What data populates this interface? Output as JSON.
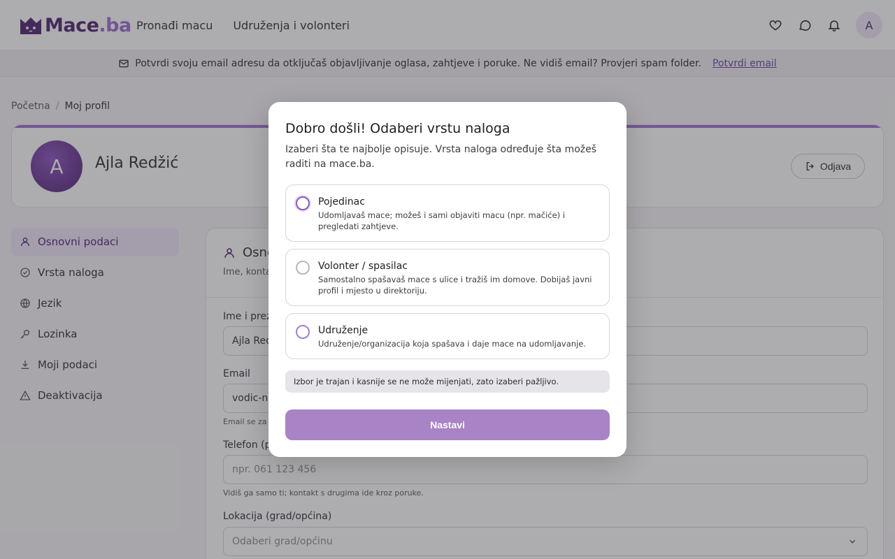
{
  "header": {
    "logo_text_main": "Mace",
    "logo_text_dot": ".ba",
    "nav": [
      {
        "label": "Pronađi macu"
      },
      {
        "label": "Udruženja i volonteri"
      }
    ],
    "icons": [
      "heart-icon",
      "chat-icon",
      "bell-icon"
    ],
    "avatar_initial": "A"
  },
  "banner": {
    "icon": "mail-icon",
    "text": "Potvrdi svoju email adresu da otključaš objavljivanje oglasa, zahtjeve i poruke. Ne vidiš email? Provjeri spam folder.",
    "link": "Potvrdi email"
  },
  "breadcrumb": {
    "home": "Početna",
    "separator": "/",
    "current": "Moj profil"
  },
  "profile": {
    "avatar_initial": "A",
    "name": "Ajla Redžić",
    "logout_label": "Odjava"
  },
  "sidebar": {
    "items": [
      {
        "label": "Osnovni podaci",
        "icon": "user-icon",
        "active": true
      },
      {
        "label": "Vrsta naloga",
        "icon": "check-circle-icon"
      },
      {
        "label": "Jezik",
        "icon": "globe-icon"
      },
      {
        "label": "Lozinka",
        "icon": "key-icon"
      },
      {
        "label": "Moji podaci",
        "icon": "download-icon"
      },
      {
        "label": "Deaktivacija",
        "icon": "warning-icon"
      }
    ]
  },
  "form": {
    "title": "Osno",
    "subtitle": "Ime, konta",
    "name_label": "Ime i prez",
    "name_value": "Ajla Red",
    "email_label": "Email",
    "email_value": "vodic-na",
    "email_help": "Email se za",
    "phone_label": "Telefon (p",
    "phone_placeholder": "npr. 061 123 456",
    "phone_help": "Vidiš ga samo ti; kontakt s drugima ide kroz poruke.",
    "location_label": "Lokacija (grad/općina)",
    "location_placeholder": "Odaberi grad/općinu"
  },
  "modal": {
    "title": "Dobro došli! Odaberi vrstu naloga",
    "description": "Izaberi šta te najbolje opisuje. Vrsta naloga određuje šta možeš raditi na mace.ba.",
    "options": [
      {
        "title": "Pojedinac",
        "description": "Udomljavaš mace; možeš i sami objaviti macu (npr. mačiće) i pregledati zahtjeve."
      },
      {
        "title": "Volonter / spasilac",
        "description": "Samostalno spašavaš mace s ulice i tražiš im domove. Dobijaš javni profil i mjesto u direktoriju."
      },
      {
        "title": "Udruženje",
        "description": "Udruženje/organizacija koja spašava i daje mace na udomljavanje."
      }
    ],
    "notice": "Izbor je trajan i kasnije se ne može mijenjati, zato izaberi pažljivo.",
    "continue_label": "Nastavi"
  },
  "colors": {
    "brand": "#4b1f6e",
    "accent": "#9b6bcf",
    "button": "#a883c5"
  }
}
